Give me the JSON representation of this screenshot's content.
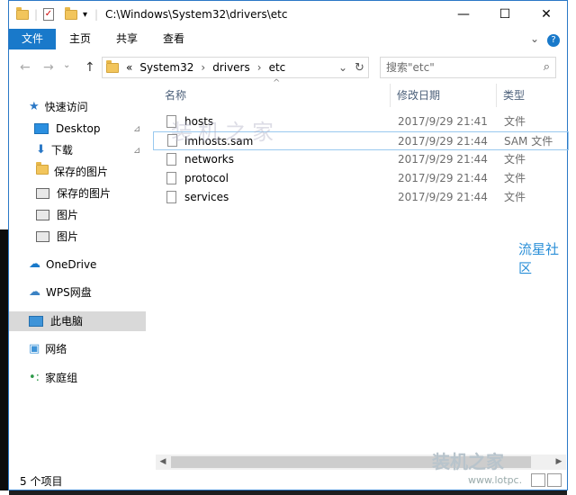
{
  "window": {
    "path_title": "C:\\Windows\\System32\\drivers\\etc",
    "minimize_glyph": "—",
    "maximize_glyph": "☐",
    "close_glyph": "✕"
  },
  "ribbon": {
    "tabs": [
      "文件",
      "主页",
      "共享",
      "查看"
    ],
    "expand_glyph": "⌄",
    "help_glyph": "?"
  },
  "nav": {
    "back_glyph": "←",
    "forward_glyph": "→",
    "up_glyph": "↑",
    "crumb_prefix": "«",
    "crumbs": [
      "System32",
      "drivers",
      "etc"
    ],
    "crumb_separator": "›",
    "dropdown_glyph": "⌄",
    "refresh_glyph": "↻",
    "search_placeholder": "搜索\"etc\"",
    "search_glyph": "⌕"
  },
  "sidebar": {
    "items": [
      {
        "label": "快速访问",
        "icon": "star-icon",
        "pinned": false
      },
      {
        "label": "Desktop",
        "icon": "desktop-icon",
        "pinned": true
      },
      {
        "label": "下载",
        "icon": "download-icon",
        "pinned": true
      },
      {
        "label": "保存的图片",
        "icon": "folder-icon",
        "pinned": false
      },
      {
        "label": "保存的图片",
        "icon": "image-folder-icon",
        "pinned": false
      },
      {
        "label": "图片",
        "icon": "image-folder-icon",
        "pinned": false
      },
      {
        "label": "图片",
        "icon": "image-folder-icon",
        "pinned": false
      },
      {
        "label": "OneDrive",
        "icon": "cloud-icon",
        "pinned": false
      },
      {
        "label": "WPS网盘",
        "icon": "cloud-outline-icon",
        "pinned": false
      },
      {
        "label": "此电脑",
        "icon": "computer-icon",
        "pinned": false
      },
      {
        "label": "网络",
        "icon": "network-icon",
        "pinned": false
      },
      {
        "label": "家庭组",
        "icon": "homegroup-icon",
        "pinned": false
      }
    ],
    "pin_glyph": "📌"
  },
  "columns": {
    "name": "名称",
    "date": "修改日期",
    "type": "类型",
    "sort_glyph": "^"
  },
  "files": [
    {
      "name": "hosts",
      "date": "2017/9/29 21:41",
      "type": "文件"
    },
    {
      "name": "lmhosts.sam",
      "date": "2017/9/29 21:44",
      "type": "SAM 文件"
    },
    {
      "name": "networks",
      "date": "2017/9/29 21:44",
      "type": "文件"
    },
    {
      "name": "protocol",
      "date": "2017/9/29 21:44",
      "type": "文件"
    },
    {
      "name": "services",
      "date": "2017/9/29 21:44",
      "type": "文件"
    }
  ],
  "status": {
    "count": "5 个项目"
  },
  "watermarks": {
    "center": "装机之家",
    "right": "流星社区",
    "bottom": "装机之家",
    "bottom_url": "www.lotpc."
  },
  "colors": {
    "accent": "#1979ca",
    "selected_bg": "#d9d9d9",
    "header_text": "#4c607a"
  }
}
